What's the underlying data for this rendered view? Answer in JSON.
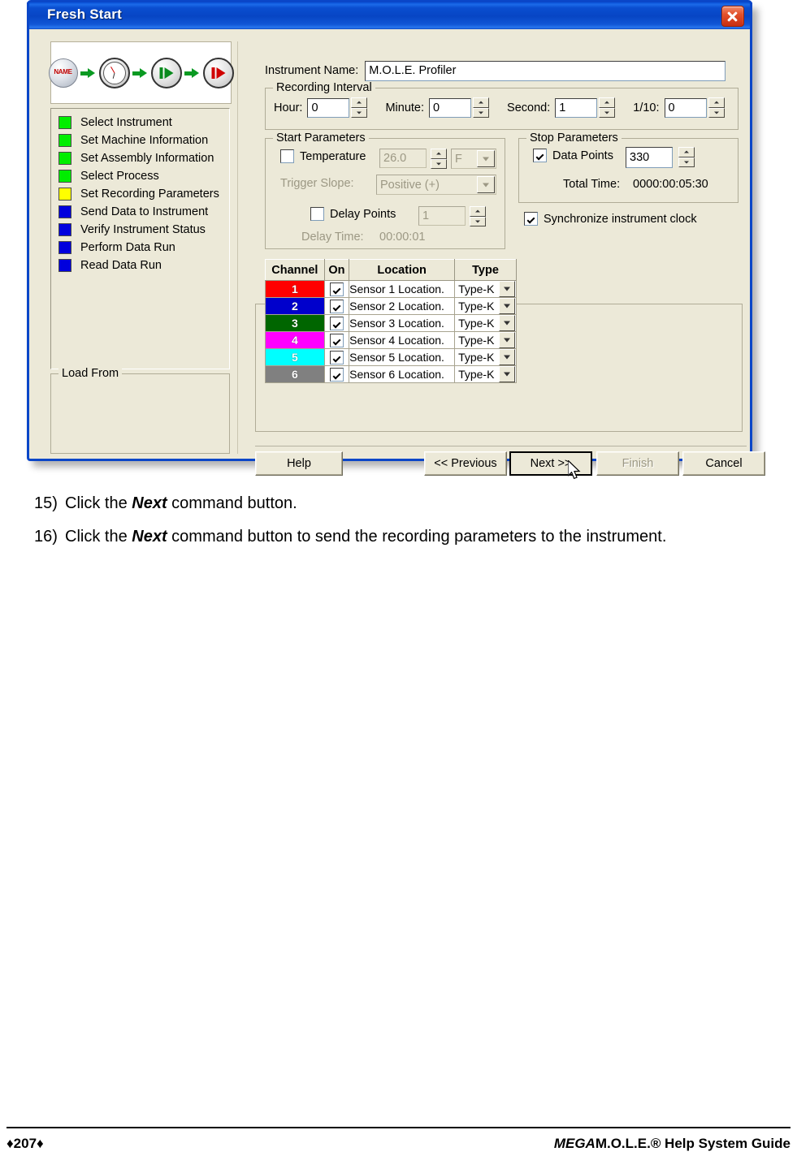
{
  "dialog": {
    "title": "Fresh Start",
    "close_label": "Close"
  },
  "wizard_icons": [
    {
      "name": "NAME"
    },
    {
      "name": "clock"
    },
    {
      "name": "green-play"
    },
    {
      "name": "red-play"
    }
  ],
  "steps": [
    {
      "label": "Select Instrument",
      "color": "#00ee00"
    },
    {
      "label": "Set Machine Information",
      "color": "#00ee00"
    },
    {
      "label": "Set Assembly Information",
      "color": "#00ee00"
    },
    {
      "label": "Select Process",
      "color": "#00ee00"
    },
    {
      "label": "Set Recording Parameters",
      "color": "#ffff00"
    },
    {
      "label": "Send Data to Instrument",
      "color": "#0000dd"
    },
    {
      "label": "Verify Instrument Status",
      "color": "#0000dd"
    },
    {
      "label": "Perform Data Run",
      "color": "#0000dd"
    },
    {
      "label": "Read Data Run",
      "color": "#0000dd"
    }
  ],
  "load_from": {
    "legend": "Load From"
  },
  "instrument": {
    "label": "Instrument Name:",
    "value": "M.O.L.E. Profiler"
  },
  "recording_interval": {
    "legend": "Recording Interval",
    "fields": [
      {
        "label": "Hour:",
        "value": "0"
      },
      {
        "label": "Minute:",
        "value": "0"
      },
      {
        "label": "Second:",
        "value": "1"
      },
      {
        "label": "1/10:",
        "value": "0"
      }
    ]
  },
  "start_parameters": {
    "legend": "Start Parameters",
    "temperature_label": "Temperature",
    "temperature_checked": false,
    "temperature_value": "26.0",
    "temperature_unit": "F",
    "trigger_slope_label": "Trigger Slope:",
    "trigger_slope_value": "Positive (+)",
    "delay_points_label": "Delay Points",
    "delay_points_checked": false,
    "delay_points_value": "1",
    "delay_time_label": "Delay Time:",
    "delay_time_value": "00:00:01"
  },
  "stop_parameters": {
    "legend": "Stop Parameters",
    "data_points_label": "Data Points",
    "data_points_checked": true,
    "data_points_value": "330",
    "total_time_label": "Total Time:",
    "total_time_value": "0000:00:05:30"
  },
  "sync_clock": {
    "label": "Synchronize instrument clock",
    "checked": true
  },
  "channel_table": {
    "headers": [
      "Channel",
      "On",
      "Location",
      "Type"
    ],
    "rows": [
      {
        "channel": "1",
        "color": "#ff0000",
        "on": true,
        "location": "Sensor 1 Location.",
        "type": "Type-K"
      },
      {
        "channel": "2",
        "color": "#0000cc",
        "on": true,
        "location": "Sensor 2 Location.",
        "type": "Type-K"
      },
      {
        "channel": "3",
        "color": "#006600",
        "on": true,
        "location": "Sensor 3 Location.",
        "type": "Type-K"
      },
      {
        "channel": "4",
        "color": "#ff00ff",
        "on": true,
        "location": "Sensor 4 Location.",
        "type": "Type-K"
      },
      {
        "channel": "5",
        "color": "#00ffff",
        "on": true,
        "location": "Sensor 5 Location.",
        "type": "Type-K"
      },
      {
        "channel": "6",
        "color": "#808080",
        "on": true,
        "location": "Sensor 6 Location.",
        "type": "Type-K"
      }
    ]
  },
  "buttons": {
    "help": "Help",
    "previous": "<< Previous",
    "next": "Next >>",
    "finish": "Finish",
    "cancel": "Cancel"
  },
  "instructions": [
    {
      "number": "15)",
      "pre": "Click the ",
      "bold": "Next",
      "post": " command button."
    },
    {
      "number": "16)",
      "pre": "Click the ",
      "bold": "Next",
      "post": " command button to send the recording parameters to the instrument."
    }
  ],
  "footer": {
    "page": "♦207♦",
    "guide_italic": "MEGA",
    "guide_rest": "M.O.L.E.® Help System Guide"
  }
}
